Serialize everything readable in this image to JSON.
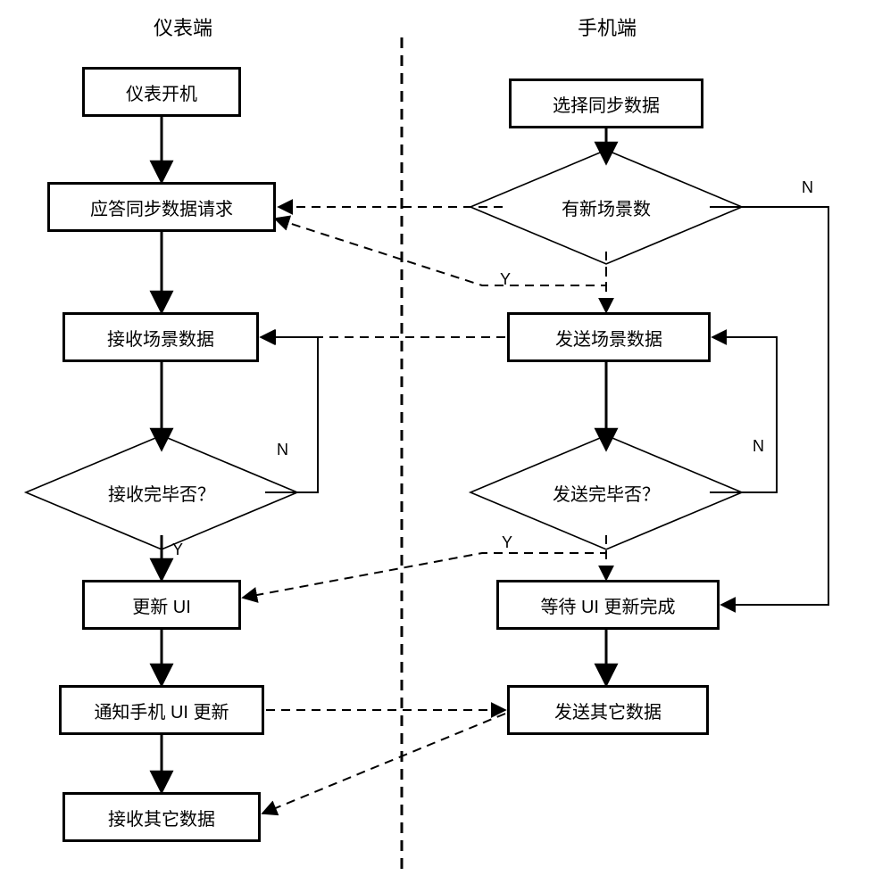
{
  "headers": {
    "left": "仪表端",
    "right": "手机端"
  },
  "left": {
    "b1": "仪表开机",
    "b2": "应答同步数据请求",
    "b3": "接收场景数据",
    "d1": "接收完毕否？",
    "b4": "更新 UI",
    "b5": "通知手机 UI 更新",
    "b6": "接收其它数据"
  },
  "right": {
    "b1": "选择同步数据",
    "d1": "有新场景数",
    "b2": "发送场景数据",
    "d2": "发送完毕否？",
    "b3": "等待 UI 更新完成",
    "b4": "发送其它数据"
  },
  "labels": {
    "yes": "Y",
    "no": "N"
  }
}
